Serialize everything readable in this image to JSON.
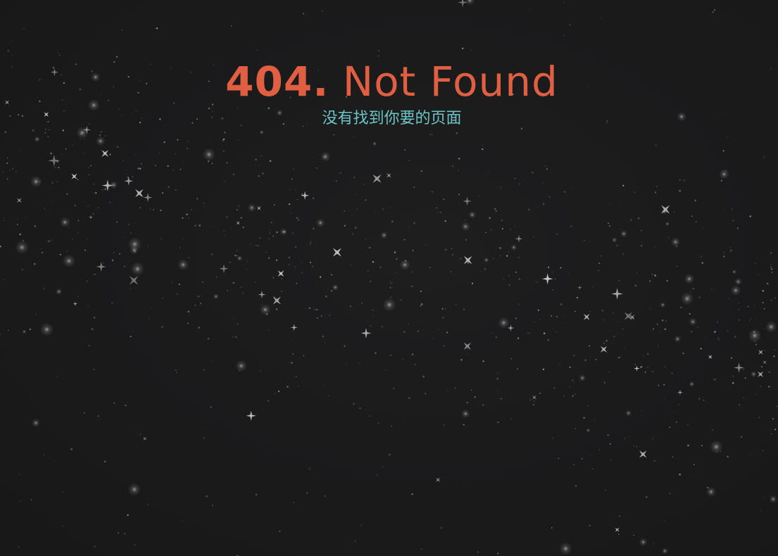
{
  "page": {
    "title_code": "404.",
    "title_text": "Not Found",
    "subtitle": "没有找到你要的页面"
  },
  "colors": {
    "background": "#1b1b1c",
    "title": "#e05f43",
    "subtitle": "#6cc4c4",
    "star": "#d8d8d8"
  },
  "icons": {
    "background": "starfield-icon"
  }
}
